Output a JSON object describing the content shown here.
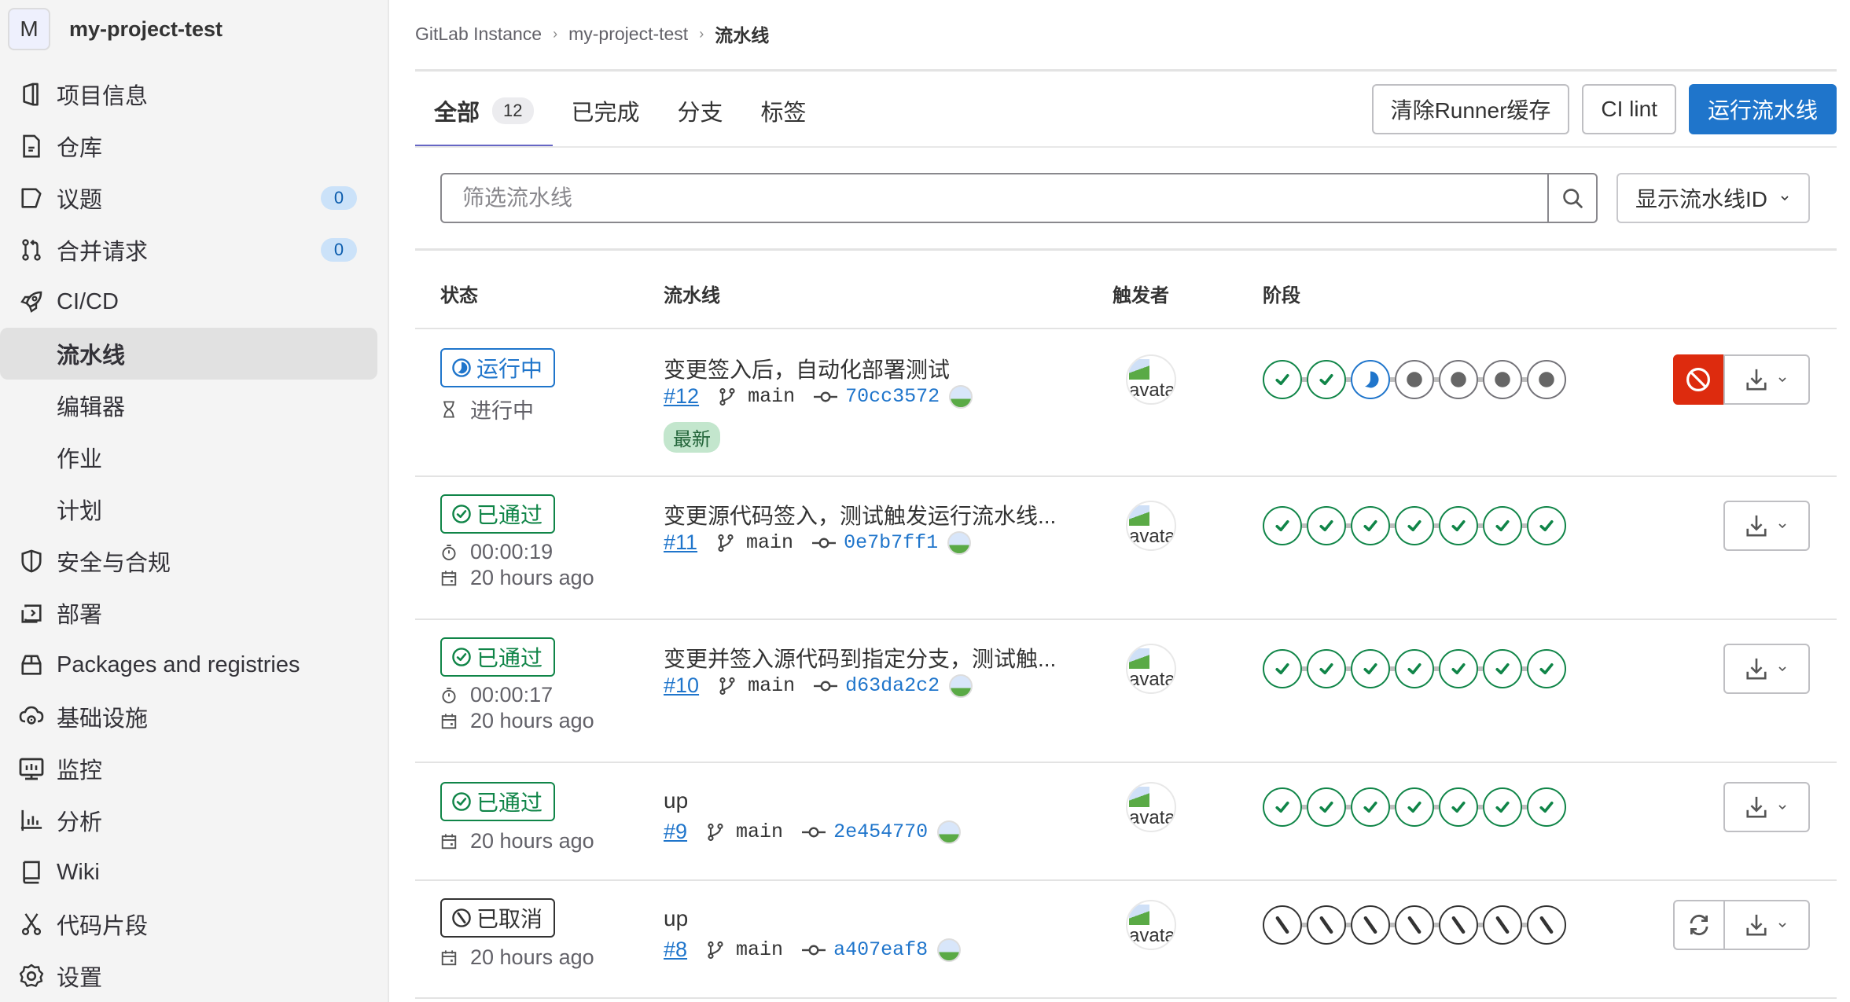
{
  "project": {
    "avatar_letter": "M",
    "name": "my-project-test"
  },
  "sidebar": {
    "items": [
      {
        "label": "项目信息",
        "icon": "project-info-icon"
      },
      {
        "label": "仓库",
        "icon": "repository-icon"
      },
      {
        "label": "议题",
        "icon": "issues-icon",
        "badge": "0"
      },
      {
        "label": "合并请求",
        "icon": "merge-request-icon",
        "badge": "0"
      },
      {
        "label": "CI/CD",
        "icon": "rocket-icon"
      },
      {
        "label": "流水线",
        "sub": true,
        "active": true
      },
      {
        "label": "编辑器",
        "sub": true
      },
      {
        "label": "作业",
        "sub": true
      },
      {
        "label": "计划",
        "sub": true
      },
      {
        "label": "安全与合规",
        "icon": "shield-icon"
      },
      {
        "label": "部署",
        "icon": "deploy-icon"
      },
      {
        "label": "Packages and registries",
        "icon": "package-icon"
      },
      {
        "label": "基础设施",
        "icon": "cloud-gear-icon"
      },
      {
        "label": "监控",
        "icon": "monitor-icon"
      },
      {
        "label": "分析",
        "icon": "chart-icon"
      },
      {
        "label": "Wiki",
        "icon": "book-icon"
      },
      {
        "label": "代码片段",
        "icon": "snippet-icon"
      },
      {
        "label": "设置",
        "icon": "settings-icon"
      }
    ]
  },
  "breadcrumb": [
    "GitLab Instance",
    "my-project-test",
    "流水线"
  ],
  "tabs": [
    {
      "label": "全部",
      "count": "12",
      "active": true
    },
    {
      "label": "已完成"
    },
    {
      "label": "分支"
    },
    {
      "label": "标签"
    }
  ],
  "actions": {
    "clear_cache": "清除Runner缓存",
    "ci_lint": "CI lint",
    "run_pipeline": "运行流水线"
  },
  "filter": {
    "placeholder": "筛选流水线",
    "value": ""
  },
  "display_dropdown": {
    "selected": "显示流水线ID"
  },
  "table": {
    "headers": {
      "status": "状态",
      "pipeline": "流水线",
      "triggerer": "触发者",
      "stages": "阶段"
    },
    "avatar_alt": "avatar",
    "rows": [
      {
        "status": "running",
        "status_label": "运行中",
        "duration": null,
        "time_label": "进行中",
        "time_icon": "hourglass-icon",
        "title": "变更签入后，自动化部署测试",
        "id": "#12",
        "branch": "main",
        "sha": "70cc3572",
        "latest_badge": "最新",
        "stages": [
          "success",
          "success",
          "running",
          "created",
          "created",
          "created",
          "created"
        ],
        "buttons": [
          "cancel",
          "download"
        ]
      },
      {
        "status": "passed",
        "status_label": "已通过",
        "duration": "00:00:19",
        "time_label": "20 hours ago",
        "title": "变更源代码签入，测试触发运行流水线...",
        "id": "#11",
        "branch": "main",
        "sha": "0e7b7ff1",
        "stages": [
          "success",
          "success",
          "success",
          "success",
          "success",
          "success",
          "success"
        ],
        "buttons": [
          "download"
        ]
      },
      {
        "status": "passed",
        "status_label": "已通过",
        "duration": "00:00:17",
        "time_label": "20 hours ago",
        "title": "变更并签入源代码到指定分支，测试触...",
        "id": "#10",
        "branch": "main",
        "sha": "d63da2c2",
        "stages": [
          "success",
          "success",
          "success",
          "success",
          "success",
          "success",
          "success"
        ],
        "buttons": [
          "download"
        ]
      },
      {
        "status": "passed",
        "status_label": "已通过",
        "duration": null,
        "time_label": "20 hours ago",
        "title": "up",
        "id": "#9",
        "branch": "main",
        "sha": "2e454770",
        "stages": [
          "success",
          "success",
          "success",
          "success",
          "success",
          "success",
          "success"
        ],
        "buttons": [
          "download"
        ]
      },
      {
        "status": "canceled",
        "status_label": "已取消",
        "duration": null,
        "time_label": "20 hours ago",
        "title": "up",
        "id": "#8",
        "branch": "main",
        "sha": "a407eaf8",
        "stages": [
          "canceled",
          "canceled",
          "canceled",
          "canceled",
          "canceled",
          "canceled",
          "canceled"
        ],
        "buttons": [
          "retry",
          "download"
        ]
      }
    ]
  },
  "colors": {
    "success": "#108548",
    "running": "#1f75cb",
    "created": "#737278",
    "canceled": "#333333",
    "danger": "#dd2b0e",
    "primary": "#1f75cb"
  }
}
